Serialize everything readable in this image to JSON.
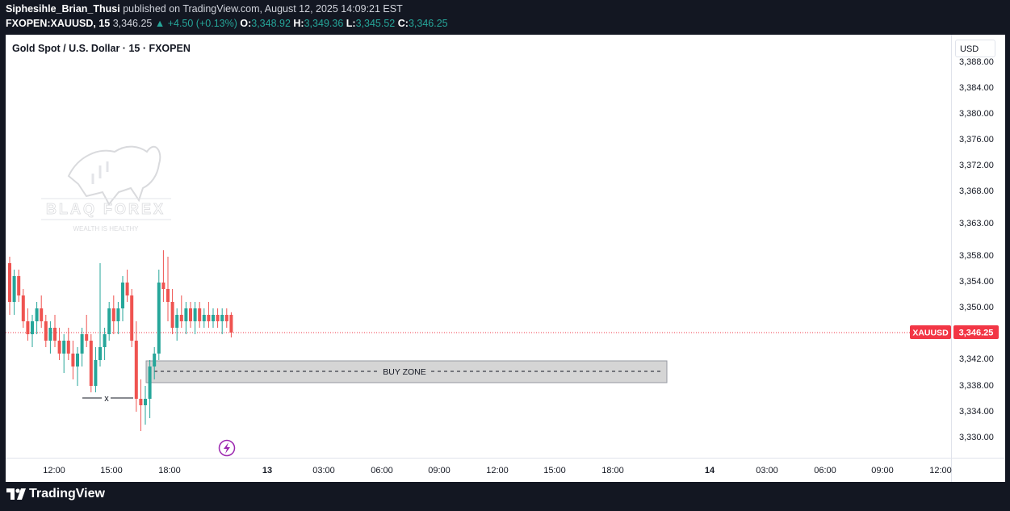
{
  "header": {
    "author": "Siphesihle_Brian_Thusi",
    "published_text": "published on TradingView.com, August 12, 2025 14:09:21 EST",
    "symbol": "FXOPEN:XAUUSD, 15",
    "last": "3,346.25",
    "change": "+4.50 (+0.13%)",
    "open_label": "O:",
    "open": "3,348.92",
    "high_label": "H:",
    "high": "3,349.36",
    "low_label": "L:",
    "low": "3,345.52",
    "close_label": "C:",
    "close": "3,346.25"
  },
  "chart": {
    "title": "Gold Spot / U.S. Dollar · 15 · FXOPEN",
    "currency": "USD",
    "price_tag_symbol": "XAUUSD",
    "price_tag_value": "3,346.25",
    "buy_zone_label": "BUY ZONE",
    "x_marker_label": "x",
    "watermark_name": "BLAQ FOREX",
    "watermark_tagline": "WEALTH IS HEALTHY",
    "y_axis_labels": [
      "3,388.00",
      "3,384.00",
      "3,380.00",
      "3,376.00",
      "3,372.00",
      "3,368.00",
      "3,363.00",
      "3,358.00",
      "3,354.00",
      "3,350.00",
      "3,342.00",
      "3,338.00",
      "3,334.00",
      "3,330.00"
    ],
    "x_axis_labels": [
      "12:00",
      "15:00",
      "18:00",
      "13",
      "03:00",
      "06:00",
      "09:00",
      "12:00",
      "15:00",
      "18:00",
      "14",
      "03:00",
      "06:00",
      "09:00",
      "12:00"
    ]
  },
  "colors": {
    "bull": "#26a69a",
    "bear": "#ef5350",
    "background": "#131722",
    "panel": "#ffffff",
    "tag": "#f23645",
    "event_icon": "#9c27b0"
  },
  "icons": {
    "event": "lightning-bolt-icon",
    "brand": "tradingview-logo-icon"
  },
  "footer": {
    "brand": "TradingView"
  }
}
